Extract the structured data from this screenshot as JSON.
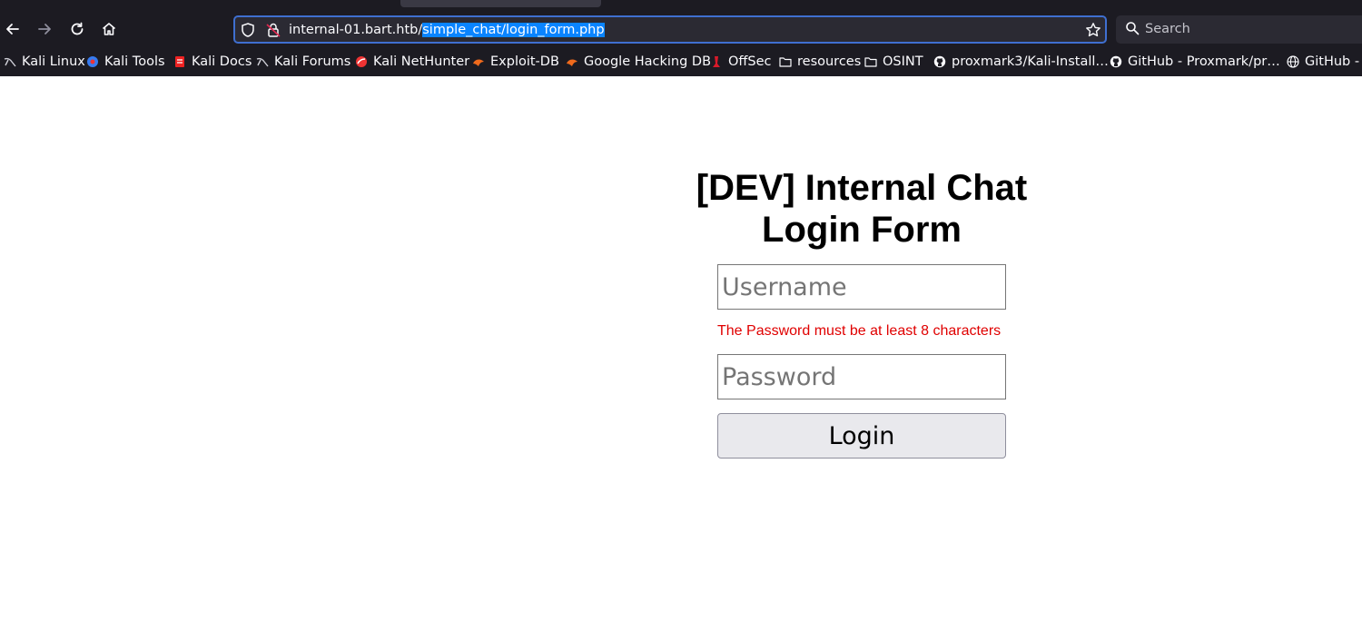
{
  "browser": {
    "url_host": "internal-01.bart.htb/",
    "url_path": "simple_chat/login_form.php",
    "search_placeholder": "Search",
    "bookmarks": [
      {
        "label": "Kali Linux",
        "icon": "kali-dragon-icon"
      },
      {
        "label": "Kali Tools",
        "icon": "kali-tools-icon"
      },
      {
        "label": "Kali Docs",
        "icon": "kali-docs-icon"
      },
      {
        "label": "Kali Forums",
        "icon": "kali-dragon-icon"
      },
      {
        "label": "Kali NetHunter",
        "icon": "nethunter-icon"
      },
      {
        "label": "Exploit-DB",
        "icon": "exploit-db-icon"
      },
      {
        "label": "Google Hacking DB",
        "icon": "exploit-db-icon"
      },
      {
        "label": "OffSec",
        "icon": "offsec-icon"
      },
      {
        "label": "resources",
        "icon": "folder-icon"
      },
      {
        "label": "OSINT",
        "icon": "folder-icon"
      },
      {
        "label": "proxmark3/Kali-Install…",
        "icon": "github-icon"
      },
      {
        "label": "GitHub - Proxmark/pr…",
        "icon": "github-icon"
      },
      {
        "label": "GitHub -",
        "icon": "globe-icon"
      }
    ]
  },
  "page": {
    "title_line1": "[DEV] Internal Chat",
    "title_line2": "Login Form",
    "username_placeholder": "Username",
    "error_message": "The Password must be at least 8 characters",
    "password_placeholder": "Password",
    "login_label": "Login"
  },
  "colors": {
    "chrome_bg": "#1c1b22",
    "url_highlight": "#0a84ff",
    "error_red": "#e00000",
    "button_bg": "#e9e9ed"
  }
}
